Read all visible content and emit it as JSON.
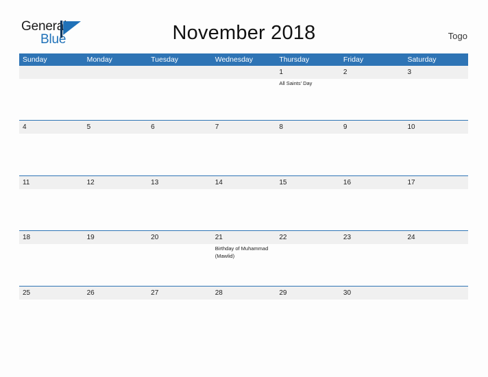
{
  "brand": {
    "name_part1": "General",
    "name_part2": "Blue",
    "flag_icon": "blue-flag-triangle-icon",
    "accent_color": "#1f71b8"
  },
  "header": {
    "title": "November 2018",
    "country": "Togo"
  },
  "theme": {
    "header_blue": "#2e74b5",
    "row_band_gray": "#f0f0f0",
    "page_background": "#fdfdfd",
    "text_color": "#1c1c1c"
  },
  "calendar": {
    "month": "November",
    "year": "2018",
    "weekday_headers": [
      "Sunday",
      "Monday",
      "Tuesday",
      "Wednesday",
      "Thursday",
      "Friday",
      "Saturday"
    ],
    "weeks": [
      [
        {
          "day": "",
          "events": []
        },
        {
          "day": "",
          "events": []
        },
        {
          "day": "",
          "events": []
        },
        {
          "day": "",
          "events": []
        },
        {
          "day": "1",
          "events": [
            "All Saints' Day"
          ]
        },
        {
          "day": "2",
          "events": []
        },
        {
          "day": "3",
          "events": []
        }
      ],
      [
        {
          "day": "4",
          "events": []
        },
        {
          "day": "5",
          "events": []
        },
        {
          "day": "6",
          "events": []
        },
        {
          "day": "7",
          "events": []
        },
        {
          "day": "8",
          "events": []
        },
        {
          "day": "9",
          "events": []
        },
        {
          "day": "10",
          "events": []
        }
      ],
      [
        {
          "day": "11",
          "events": []
        },
        {
          "day": "12",
          "events": []
        },
        {
          "day": "13",
          "events": []
        },
        {
          "day": "14",
          "events": []
        },
        {
          "day": "15",
          "events": []
        },
        {
          "day": "16",
          "events": []
        },
        {
          "day": "17",
          "events": []
        }
      ],
      [
        {
          "day": "18",
          "events": []
        },
        {
          "day": "19",
          "events": []
        },
        {
          "day": "20",
          "events": []
        },
        {
          "day": "21",
          "events": [
            "Birthday of Muhammad (Mawlid)"
          ]
        },
        {
          "day": "22",
          "events": []
        },
        {
          "day": "23",
          "events": []
        },
        {
          "day": "24",
          "events": []
        }
      ],
      [
        {
          "day": "25",
          "events": []
        },
        {
          "day": "26",
          "events": []
        },
        {
          "day": "27",
          "events": []
        },
        {
          "day": "28",
          "events": []
        },
        {
          "day": "29",
          "events": []
        },
        {
          "day": "30",
          "events": []
        },
        {
          "day": "",
          "events": []
        }
      ]
    ]
  }
}
